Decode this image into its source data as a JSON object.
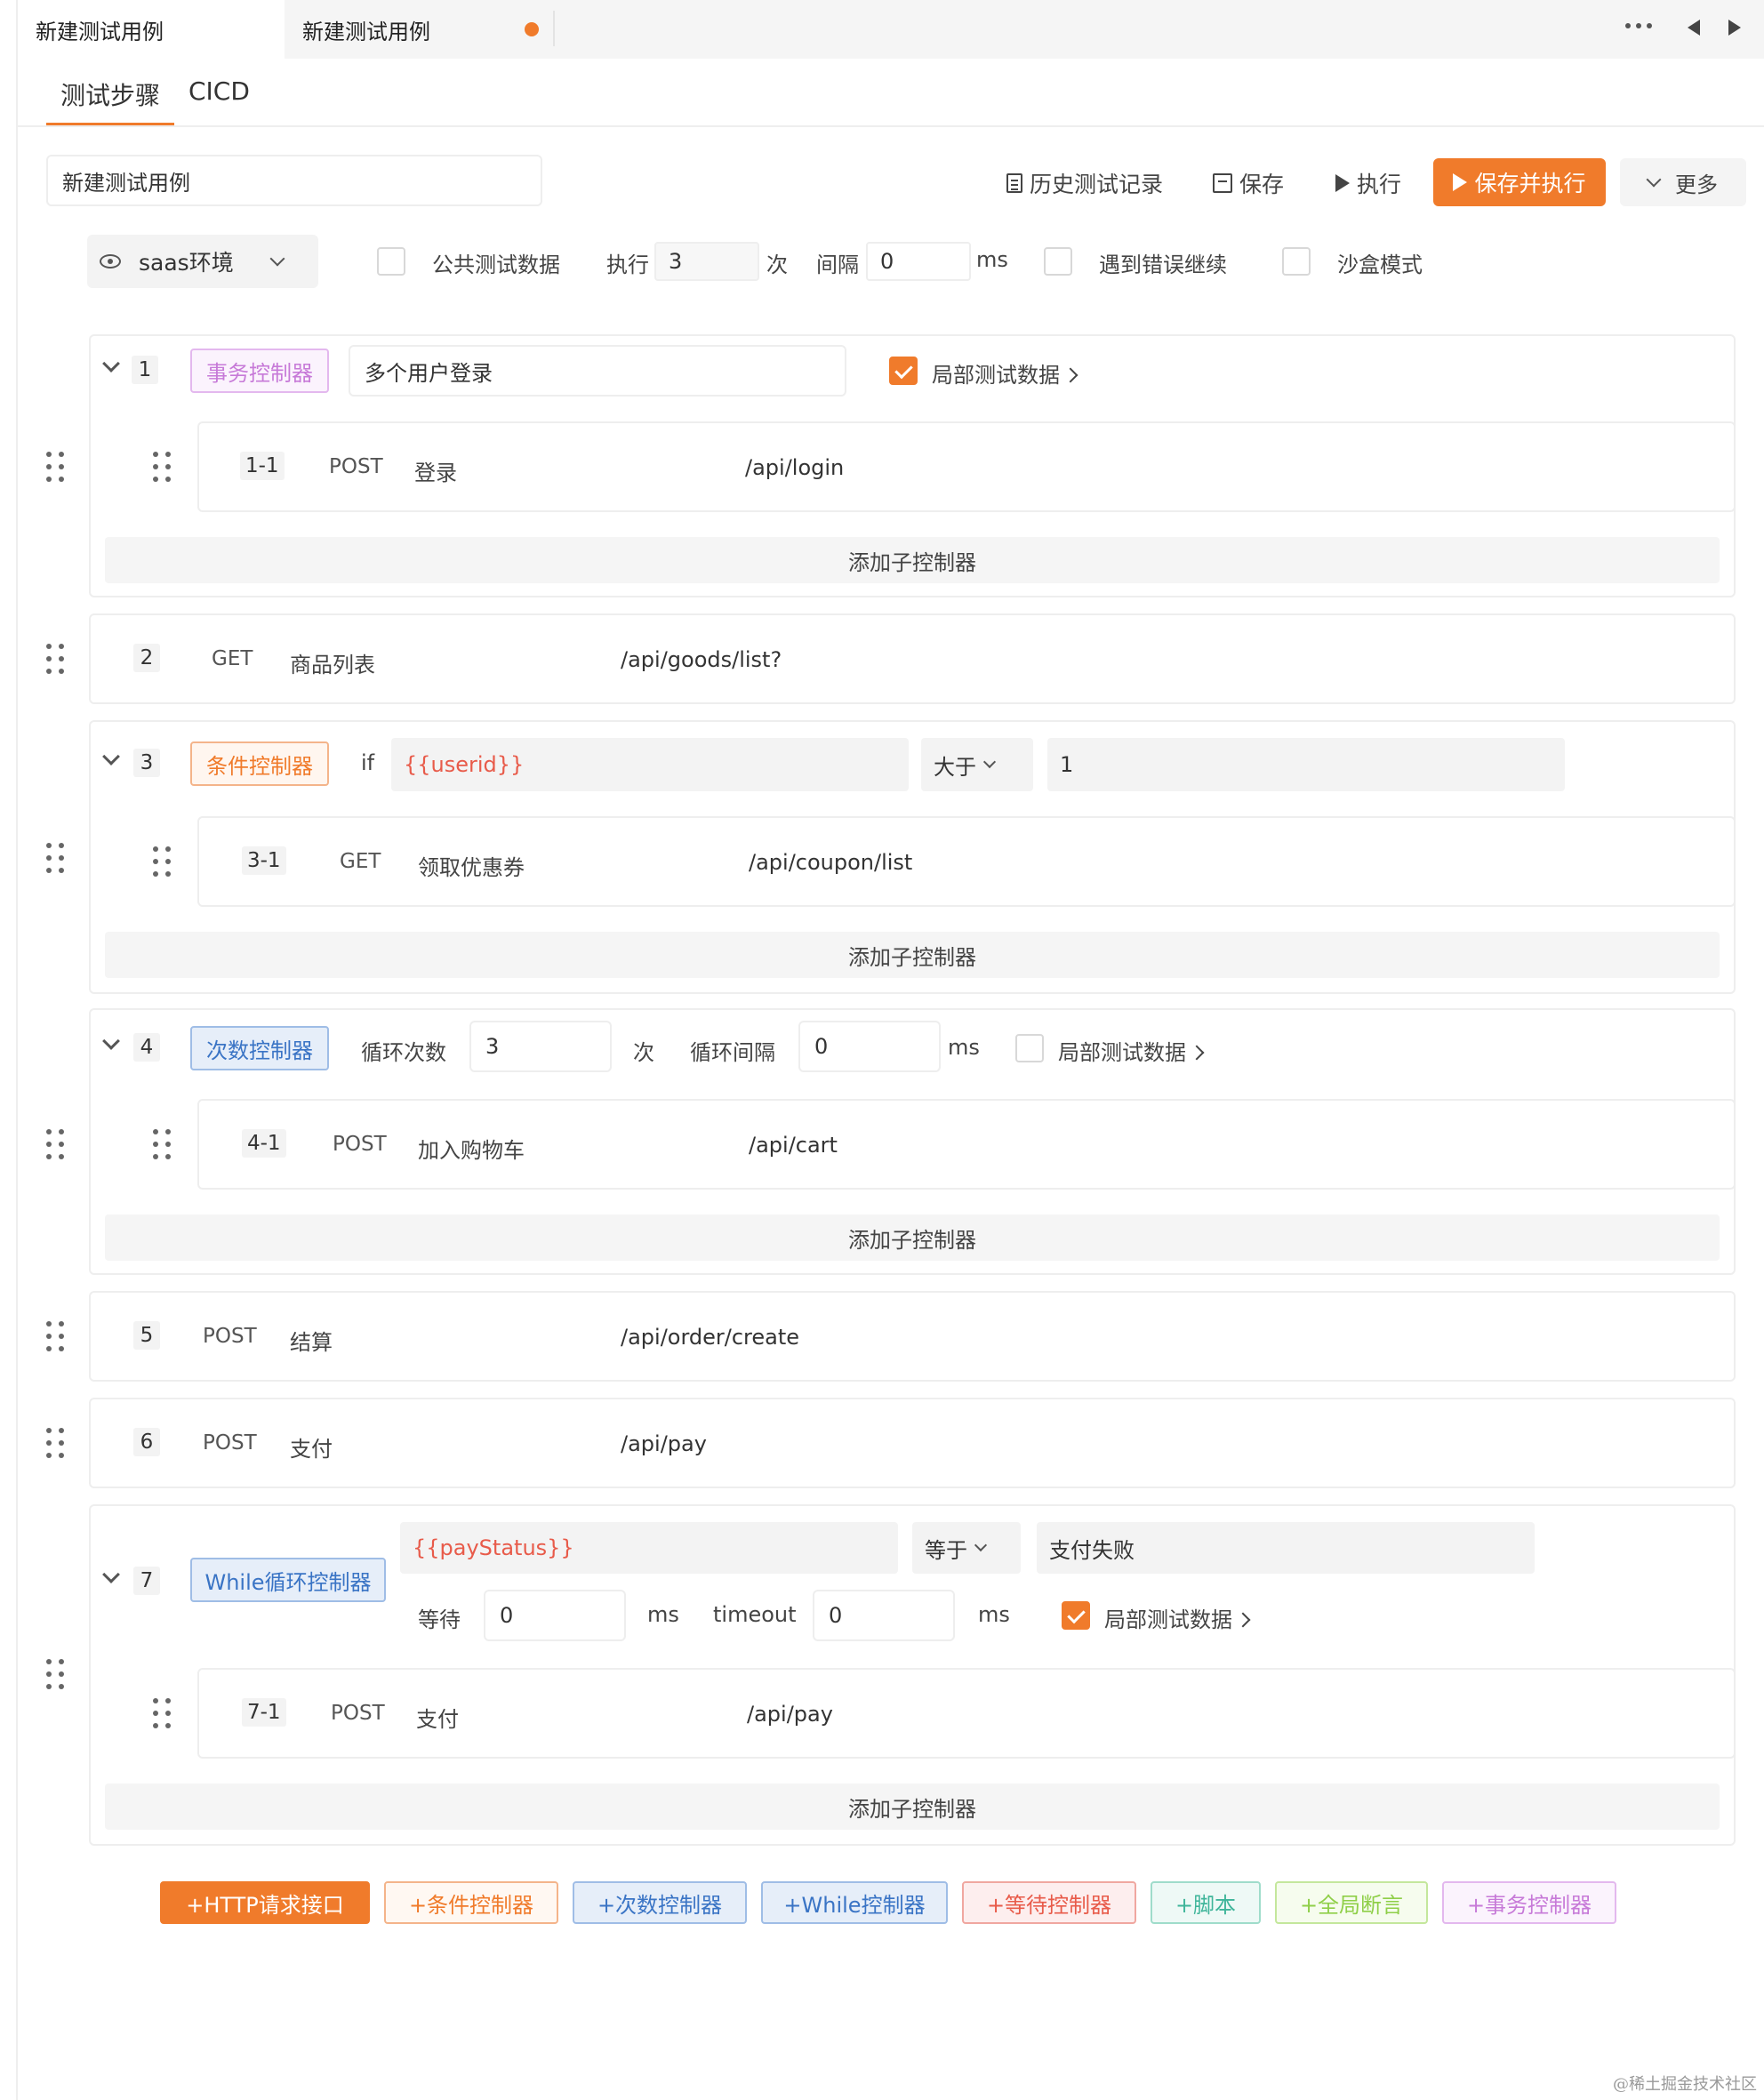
{
  "tabs": [
    {
      "label": "新建测试用例"
    },
    {
      "label": "新建测试用例"
    }
  ],
  "subtabs": [
    "测试步骤",
    "CICD"
  ],
  "toolbar": {
    "case_name": "新建测试用例",
    "history": "历史测试记录",
    "save": "保存",
    "run": "执行",
    "save_run": "保存并执行",
    "more": "更多"
  },
  "settings": {
    "env": "saas环境",
    "public_data": "公共测试数据",
    "exec_label": "执行",
    "exec_times": "3",
    "times_unit": "次",
    "interval_label": "间隔",
    "interval_value": "0",
    "ms": "ms",
    "continue_on_error": "遇到错误继续",
    "sandbox": "沙盒模式"
  },
  "steps": {
    "s1": {
      "num": "1",
      "tag": "事务控制器",
      "name": "多个用户登录",
      "local_data": "局部测试数据",
      "child": {
        "num": "1-1",
        "method": "POST",
        "name": "登录",
        "path": "/api/login"
      }
    },
    "s2": {
      "num": "2",
      "method": "GET",
      "name": "商品列表",
      "path": "/api/goods/list?"
    },
    "s3": {
      "num": "3",
      "tag": "条件控制器",
      "if": "if",
      "var": "{{userid}}",
      "op": "大于",
      "value": "1",
      "child": {
        "num": "3-1",
        "method": "GET",
        "name": "领取优惠券",
        "path": "/api/coupon/list"
      }
    },
    "s4": {
      "num": "4",
      "tag": "次数控制器",
      "loop_label": "循环次数",
      "loop_value": "3",
      "times_unit": "次",
      "interval_label": "循环间隔",
      "interval_value": "0",
      "ms": "ms",
      "local_data": "局部测试数据",
      "child": {
        "num": "4-1",
        "method": "POST",
        "name": "加入购物车",
        "path": "/api/cart"
      }
    },
    "s5": {
      "num": "5",
      "method": "POST",
      "name": "结算",
      "path": "/api/order/create"
    },
    "s6": {
      "num": "6",
      "method": "POST",
      "name": "支付",
      "path": "/api/pay"
    },
    "s7": {
      "num": "7",
      "tag": "While循环控制器",
      "var": "{{payStatus}}",
      "op": "等于",
      "value": "支付失败",
      "wait_label": "等待",
      "wait_value": "0",
      "ms": "ms",
      "timeout_label": "timeout",
      "timeout_value": "0",
      "local_data": "局部测试数据",
      "child": {
        "num": "7-1",
        "method": "POST",
        "name": "支付",
        "path": "/api/pay"
      }
    }
  },
  "add_child": "添加子控制器",
  "add_buttons": {
    "http": "+HTTP请求接口",
    "cond": "+条件控制器",
    "count": "+次数控制器",
    "while": "+While控制器",
    "wait": "+等待控制器",
    "script": "+脚本",
    "assert": "+全局断言",
    "txn": "+事务控制器"
  },
  "watermark": "@稀土掘金技术社区",
  "colors": {
    "accent": "#f07b2b",
    "txn": "#c77ad8",
    "cond": "#f07b2b",
    "count": "#3a74c5",
    "wait": "#e85b4a",
    "script": "#3fb59a",
    "assert": "#8fcf48",
    "var_red": "#e85b4a"
  }
}
